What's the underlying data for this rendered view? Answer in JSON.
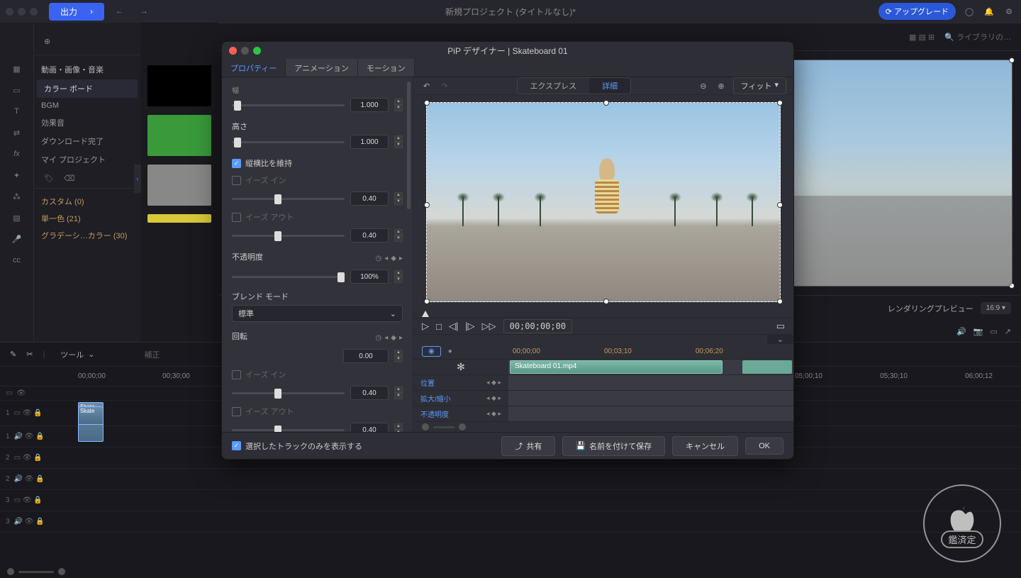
{
  "topbar": {
    "output": "出力",
    "title": "新規プロジェクト (タイトルなし)*",
    "upgrade": "アップグレード"
  },
  "leftpanel": {
    "add_icon_row": "",
    "header": "動画・画像・音楽",
    "items": [
      "カラー ボード",
      "BGM",
      "効果音",
      "ダウンロード完了",
      "マイ プロジェクト"
    ],
    "cats": [
      "カスタム (0)",
      "単一色 (21)",
      "グラデーシ…カラー (30)"
    ]
  },
  "preview": {
    "rendering": "レンダリングプレビュー",
    "ratio": "16:9"
  },
  "timeline": {
    "tools": "ツール",
    "correction": "補正",
    "ruler": [
      "00;00;00",
      "00;30;00",
      "",
      "",
      "",
      "",
      "",
      "",
      "",
      "05;00;10",
      "05;30;10",
      "06;00;12"
    ],
    "clip1": "Skate",
    "clip2": "Skate",
    "tracks": [
      "1",
      "1",
      "2",
      "2",
      "3",
      "3"
    ]
  },
  "modal": {
    "title": "PiP デザイナー  |  Skateboard 01",
    "tabs": [
      "プロパティー",
      "アニメーション",
      "モーション"
    ],
    "seg": [
      "エクスプレス",
      "詳細"
    ],
    "fit": "フィット",
    "props": {
      "width_label": "幅",
      "width_val": "1.000",
      "height_label": "高さ",
      "height_val": "1.000",
      "aspect": "縦横比を維持",
      "easein": "イーズ イン",
      "easein_val": "0.40",
      "easeout": "イーズ アウト",
      "easeout_val": "0.40",
      "opacity": "不透明度",
      "opacity_val": "100%",
      "blend": "ブレンド モード",
      "blend_val": "標準",
      "rotation": "回転",
      "rotation_val": "0.00",
      "easein2": "イーズ イン",
      "easein2_val": "0.40",
      "easeout2": "イーズ アウト",
      "easeout2_val": "0.40"
    },
    "timecode": "00;00;00;00",
    "kf_ruler": [
      "00;00;00",
      "00;03;10",
      "00;06;20"
    ],
    "kf_clip": "Skateboard 01.mp4",
    "kf_rows": [
      "位置",
      "拡大/縮小",
      "不透明度"
    ],
    "footer": {
      "track_only": "選択したトラックのみを表示する",
      "share": "共有",
      "save_as": "名前を付けて保存",
      "cancel": "キャンセル",
      "ok": "OK"
    }
  },
  "watermark": "鑑済定"
}
